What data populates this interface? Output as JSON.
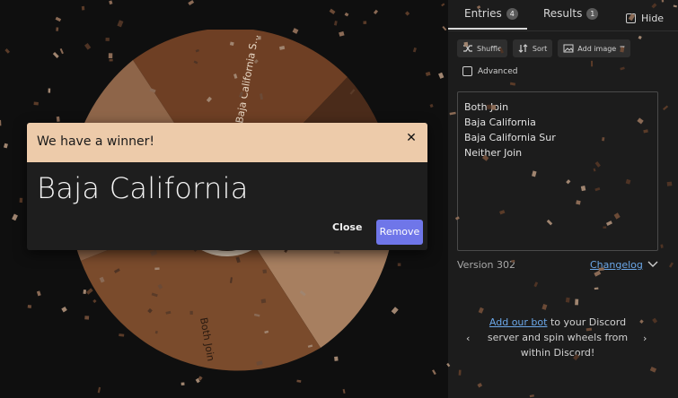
{
  "tabs": {
    "entries_label": "Entries",
    "entries_count": "4",
    "results_label": "Results",
    "results_count": "1",
    "hide_label": "Hide"
  },
  "toolbar": {
    "shuffle_label": "Shuffle",
    "sort_label": "Sort",
    "add_image_label": "Add image"
  },
  "advanced_label": "Advanced",
  "entries": [
    {
      "text": "Both Join"
    },
    {
      "text": "Baja California"
    },
    {
      "text": "Baja California Sur"
    },
    {
      "text": "Neither Join"
    }
  ],
  "version_text": "Version 302",
  "changelog_label": "Changelog",
  "promo": {
    "link_text": "Add our bot",
    "line1_rest": " to your Discord",
    "line2": "server and spin wheels from",
    "line3": "within Discord!"
  },
  "wheel": {
    "label_top": "Baja California S...",
    "label_bottom": "Both Join",
    "colors": [
      "#6e3f24",
      "#8e6549",
      "#4a2b1a",
      "#a77f60",
      "#7a4b2c"
    ]
  },
  "modal": {
    "title": "We have a winner!",
    "winner": "Baja California",
    "close_label": "Close",
    "remove_label": "Remove",
    "header_color": "#edcbaa",
    "remove_color": "#6f76e9"
  }
}
